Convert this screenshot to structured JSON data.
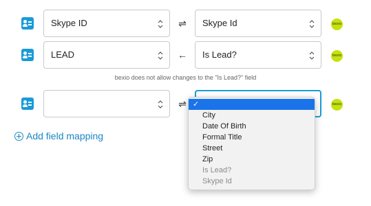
{
  "rows": [
    {
      "left_value": "Skype ID",
      "arrow": "⇌",
      "right_value": "Skype Id",
      "logo_text": "bexio"
    },
    {
      "left_value": "LEAD",
      "arrow": "←",
      "right_value": "Is Lead?",
      "logo_text": "bexio",
      "note": "bexio does not allow changes to the \"Is Lead?\" field"
    },
    {
      "left_value": "",
      "arrow": "⇌",
      "right_value": "",
      "logo_text": "bexio"
    }
  ],
  "dropdown": {
    "selected_mark": "✓",
    "items": [
      {
        "label": "City",
        "disabled": false
      },
      {
        "label": "Date Of Birth",
        "disabled": false
      },
      {
        "label": "Formal Title",
        "disabled": false
      },
      {
        "label": "Street",
        "disabled": false
      },
      {
        "label": "Zip",
        "disabled": false
      },
      {
        "label": "Is Lead?",
        "disabled": true
      },
      {
        "label": "Skype Id",
        "disabled": true
      }
    ]
  },
  "add_mapping_label": "Add field mapping",
  "colors": {
    "accent": "#1a9bd8",
    "link": "#1a86c4",
    "bexio_green": "#c6e20a",
    "selection": "#1a73e8"
  }
}
